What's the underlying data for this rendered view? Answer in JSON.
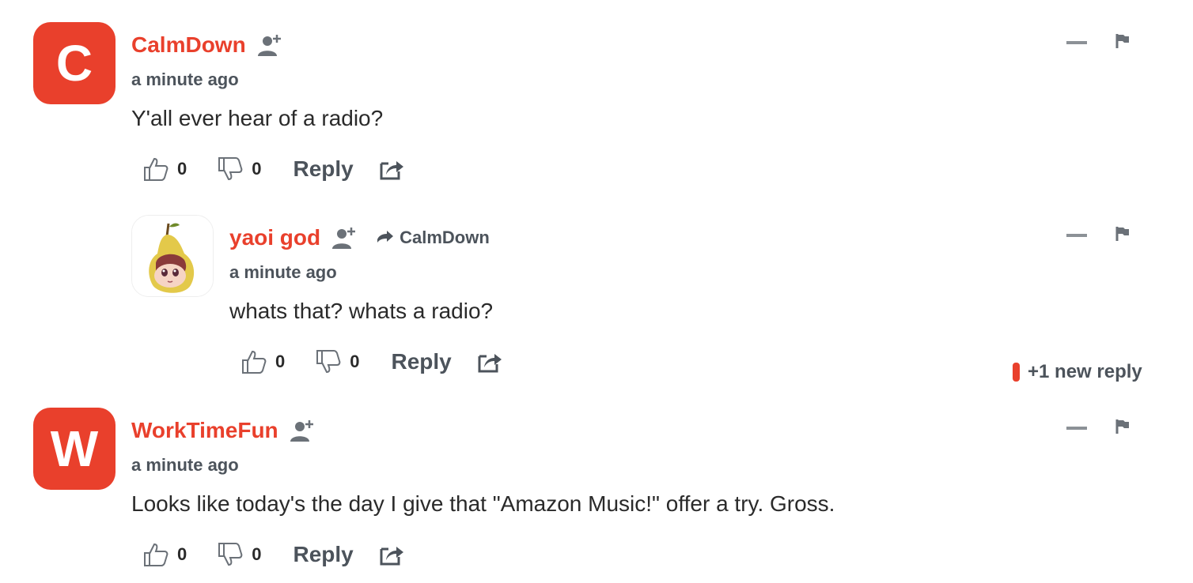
{
  "comments": [
    {
      "avatar_letter": "C",
      "author": "CalmDown",
      "time": "a minute ago",
      "text": "Y'all ever hear of a radio?",
      "upvotes": "0",
      "downvotes": "0",
      "reply_label": "Reply"
    },
    {
      "author": "yaoi god",
      "reply_to": "CalmDown",
      "time": "a minute ago",
      "text": "whats that? whats a radio?",
      "upvotes": "0",
      "downvotes": "0",
      "reply_label": "Reply",
      "new_replies": "+1 new reply"
    },
    {
      "avatar_letter": "W",
      "author": "WorkTimeFun",
      "time": "a minute ago",
      "text": "Looks like today's the day I give that \"Amazon Music!\" offer a try. Gross.",
      "upvotes": "0",
      "downvotes": "0",
      "reply_label": "Reply"
    }
  ],
  "colors": {
    "accent": "#e9402c",
    "muted": "#4c535b",
    "icon": "#6b7178"
  },
  "icons": [
    "follow-user-icon",
    "thumbs-up-icon",
    "thumbs-down-icon",
    "share-icon",
    "flag-icon",
    "collapse-icon",
    "reply-arrow-icon"
  ]
}
